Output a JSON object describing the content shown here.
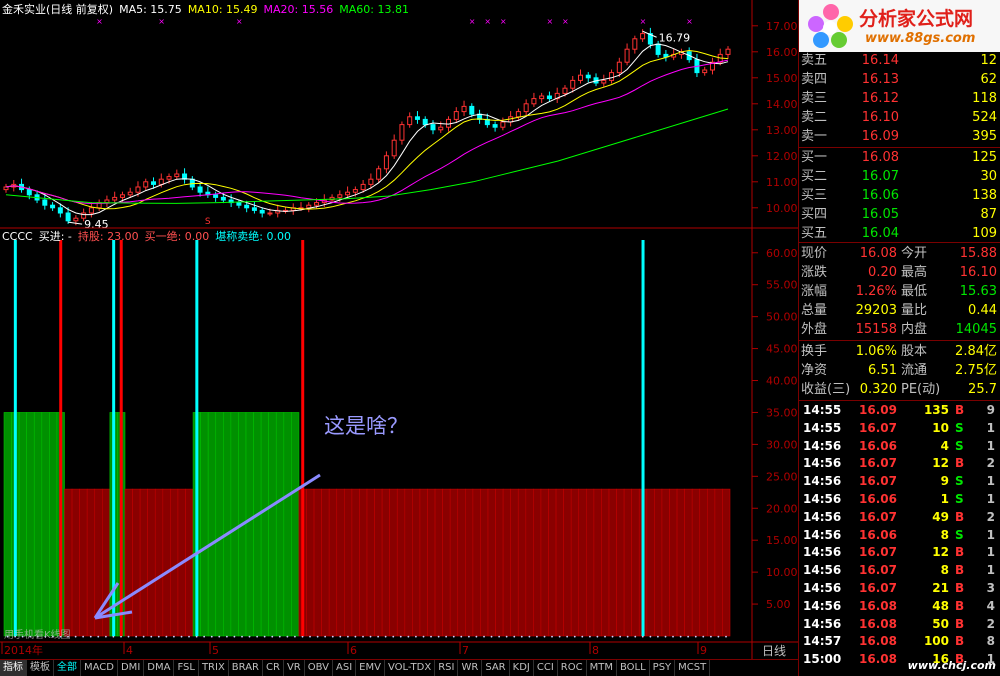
{
  "header": {
    "name": "金禾实业(日线 前复权)",
    "ma5": "MA5: 15.75",
    "ma10": "MA10: 15.49",
    "ma20": "MA20: 15.56",
    "ma60": "MA60: 13.81"
  },
  "indicator_header": {
    "name": "CCCC",
    "buy": "买进: -",
    "hold": "持股: 23.00",
    "buy_one": "买一绝: 0.00",
    "sell": "堪称卖绝: 0.00"
  },
  "annotation": "这是啥？",
  "overlay_small_label": "用手机看K线图",
  "price_markers": {
    "high": "16.79",
    "low": "9.45"
  },
  "bottom_tabs": [
    "指标",
    "模板",
    "全部",
    "MACD",
    "DMI",
    "DMA",
    "FSL",
    "TRIX",
    "BRAR",
    "CR",
    "VR",
    "OBV",
    "ASI",
    "EMV",
    "VOL-TDX",
    "RSI",
    "WR",
    "SAR",
    "KDJ",
    "CCI",
    "ROC",
    "MTM",
    "BOLL",
    "PSY",
    "MCST"
  ],
  "period_label": "日线",
  "logo": {
    "title": "分析家公式网",
    "url": "www.88gs.com"
  },
  "watermark": "www.chcj.com",
  "colors": {
    "up": "#ff3232",
    "down": "#00ffff",
    "green": "#00e600",
    "yellow": "#ffff00",
    "axis": "#b00000",
    "bg": "#000000"
  },
  "order_book": {
    "asks": [
      {
        "label": "卖五",
        "price": "16.14",
        "vol": "12"
      },
      {
        "label": "卖四",
        "price": "16.13",
        "vol": "62"
      },
      {
        "label": "卖三",
        "price": "16.12",
        "vol": "118"
      },
      {
        "label": "卖二",
        "price": "16.10",
        "vol": "524"
      },
      {
        "label": "卖一",
        "price": "16.09",
        "vol": "395"
      }
    ],
    "bids": [
      {
        "label": "买一",
        "price": "16.08",
        "vol": "125"
      },
      {
        "label": "买二",
        "price": "16.07",
        "vol": "30"
      },
      {
        "label": "买三",
        "price": "16.06",
        "vol": "138"
      },
      {
        "label": "买四",
        "price": "16.05",
        "vol": "87"
      },
      {
        "label": "买五",
        "price": "16.04",
        "vol": "109"
      }
    ]
  },
  "stats": [
    {
      "l1": "现价",
      "v1": "16.08",
      "l2": "今开",
      "v2": "15.88",
      "c1": "#ff3232",
      "c2": "#ff3232"
    },
    {
      "l1": "涨跌",
      "v1": "0.20",
      "l2": "最高",
      "v2": "16.10",
      "c1": "#ff3232",
      "c2": "#ff3232"
    },
    {
      "l1": "涨幅",
      "v1": "1.26%",
      "l2": "最低",
      "v2": "15.63",
      "c1": "#ff3232",
      "c2": "#00e600"
    },
    {
      "l1": "总量",
      "v1": "29203",
      "l2": "量比",
      "v2": "0.44",
      "c1": "#ffff00",
      "c2": "#ffff00"
    },
    {
      "l1": "外盘",
      "v1": "15158",
      "l2": "内盘",
      "v2": "14045",
      "c1": "#ff3232",
      "c2": "#00e600"
    }
  ],
  "stats2": [
    {
      "l1": "换手",
      "v1": "1.06%",
      "l2": "股本",
      "v2": "2.84亿"
    },
    {
      "l1": "净资",
      "v1": "6.51",
      "l2": "流通",
      "v2": "2.75亿"
    },
    {
      "l1": "收益(三)",
      "v1": "0.320",
      "l2": "PE(动)",
      "v2": "25.7"
    }
  ],
  "trades": [
    {
      "time": "14:55",
      "price": "16.09",
      "vol": "135",
      "side": "B",
      "num": "9"
    },
    {
      "time": "14:55",
      "price": "16.07",
      "vol": "10",
      "side": "S",
      "num": "1"
    },
    {
      "time": "14:56",
      "price": "16.06",
      "vol": "4",
      "side": "S",
      "num": "1"
    },
    {
      "time": "14:56",
      "price": "16.07",
      "vol": "12",
      "side": "B",
      "num": "2"
    },
    {
      "time": "14:56",
      "price": "16.07",
      "vol": "9",
      "side": "S",
      "num": "1"
    },
    {
      "time": "14:56",
      "price": "16.06",
      "vol": "1",
      "side": "S",
      "num": "1"
    },
    {
      "time": "14:56",
      "price": "16.07",
      "vol": "49",
      "side": "B",
      "num": "2"
    },
    {
      "time": "14:56",
      "price": "16.06",
      "vol": "8",
      "side": "S",
      "num": "1"
    },
    {
      "time": "14:56",
      "price": "16.07",
      "vol": "12",
      "side": "B",
      "num": "1"
    },
    {
      "time": "14:56",
      "price": "16.07",
      "vol": "8",
      "side": "B",
      "num": "1"
    },
    {
      "time": "14:56",
      "price": "16.07",
      "vol": "21",
      "side": "B",
      "num": "3"
    },
    {
      "time": "14:56",
      "price": "16.08",
      "vol": "48",
      "side": "B",
      "num": "4"
    },
    {
      "time": "14:56",
      "price": "16.08",
      "vol": "50",
      "side": "B",
      "num": "2"
    },
    {
      "time": "14:57",
      "price": "16.08",
      "vol": "100",
      "side": "B",
      "num": "8"
    },
    {
      "time": "15:00",
      "price": "16.08",
      "vol": "16",
      "side": "B",
      "num": "1"
    }
  ],
  "chart_data": [
    {
      "type": "candlestick",
      "title": "金禾实业(日线 前复权)",
      "y_ticks": [
        "17.00",
        "16.00",
        "15.00",
        "14.00",
        "13.00",
        "12.00",
        "11.00",
        "10.00"
      ],
      "ylim": [
        9.3,
        17.3
      ],
      "x_labels": [
        "2014年",
        "4",
        "5",
        "6",
        "7",
        "8",
        "9"
      ],
      "series": [
        {
          "name": "MA5",
          "value": "15.75",
          "color": "#ffffff"
        },
        {
          "name": "MA10",
          "value": "15.49",
          "color": "#ffff00"
        },
        {
          "name": "MA20",
          "value": "15.56",
          "color": "#ff00ff"
        },
        {
          "name": "MA60",
          "value": "13.81",
          "color": "#00ff00"
        }
      ],
      "price_path": [
        10.8,
        10.9,
        10.7,
        10.5,
        10.3,
        10.1,
        10.0,
        9.8,
        9.5,
        9.6,
        9.8,
        10.0,
        10.2,
        10.3,
        10.4,
        10.5,
        10.6,
        10.8,
        11.0,
        10.9,
        11.1,
        11.2,
        11.3,
        11.1,
        10.8,
        10.6,
        10.5,
        10.4,
        10.3,
        10.2,
        10.1,
        10.0,
        9.9,
        9.8,
        9.8,
        9.9,
        9.9,
        10.0,
        10.0,
        10.1,
        10.2,
        10.3,
        10.4,
        10.5,
        10.6,
        10.7,
        10.9,
        11.1,
        11.5,
        12.0,
        12.6,
        13.2,
        13.5,
        13.4,
        13.2,
        13.0,
        13.1,
        13.4,
        13.7,
        13.9,
        13.6,
        13.4,
        13.2,
        13.1,
        13.3,
        13.5,
        13.7,
        14.0,
        14.2,
        14.3,
        14.2,
        14.4,
        14.6,
        14.9,
        15.1,
        15.0,
        14.8,
        14.9,
        15.2,
        15.6,
        16.1,
        16.5,
        16.7,
        16.3,
        15.9,
        15.8,
        15.9,
        16.0,
        15.7,
        15.2,
        15.3,
        15.6,
        15.9,
        16.1
      ],
      "ma60_path": [
        10.5,
        10.35,
        10.2,
        10.18,
        10.17,
        10.2,
        10.25,
        10.3,
        10.35,
        10.45,
        10.7,
        11.0,
        11.4,
        11.8,
        12.3,
        12.8,
        13.3,
        13.8
      ],
      "high_label": "16.79",
      "low_label": "9.45"
    },
    {
      "type": "bar",
      "title": "CCCC",
      "y_ticks": [
        "60.00",
        "55.00",
        "50.00",
        "45.00",
        "40.00",
        "35.00",
        "30.00",
        "25.00",
        "20.00",
        "15.00",
        "10.00",
        "5.00"
      ],
      "ylim": [
        0,
        62
      ],
      "bar_count": 96,
      "green_ranges": [
        [
          0,
          7
        ],
        [
          14,
          15
        ],
        [
          25,
          38
        ]
      ],
      "red_value": 23,
      "green_value": 35,
      "spikes": [
        {
          "index": 1,
          "color": "#00ffff",
          "value": 62
        },
        {
          "index": 7,
          "color": "#ff0000",
          "value": 62
        },
        {
          "index": 14,
          "color": "#00ffff",
          "value": 62
        },
        {
          "index": 15,
          "color": "#ff0000",
          "value": 62
        },
        {
          "index": 25,
          "color": "#00ffff",
          "value": 62
        },
        {
          "index": 39,
          "color": "#ff0000",
          "value": 62
        },
        {
          "index": 84,
          "color": "#00ffff",
          "value": 62
        }
      ]
    }
  ]
}
